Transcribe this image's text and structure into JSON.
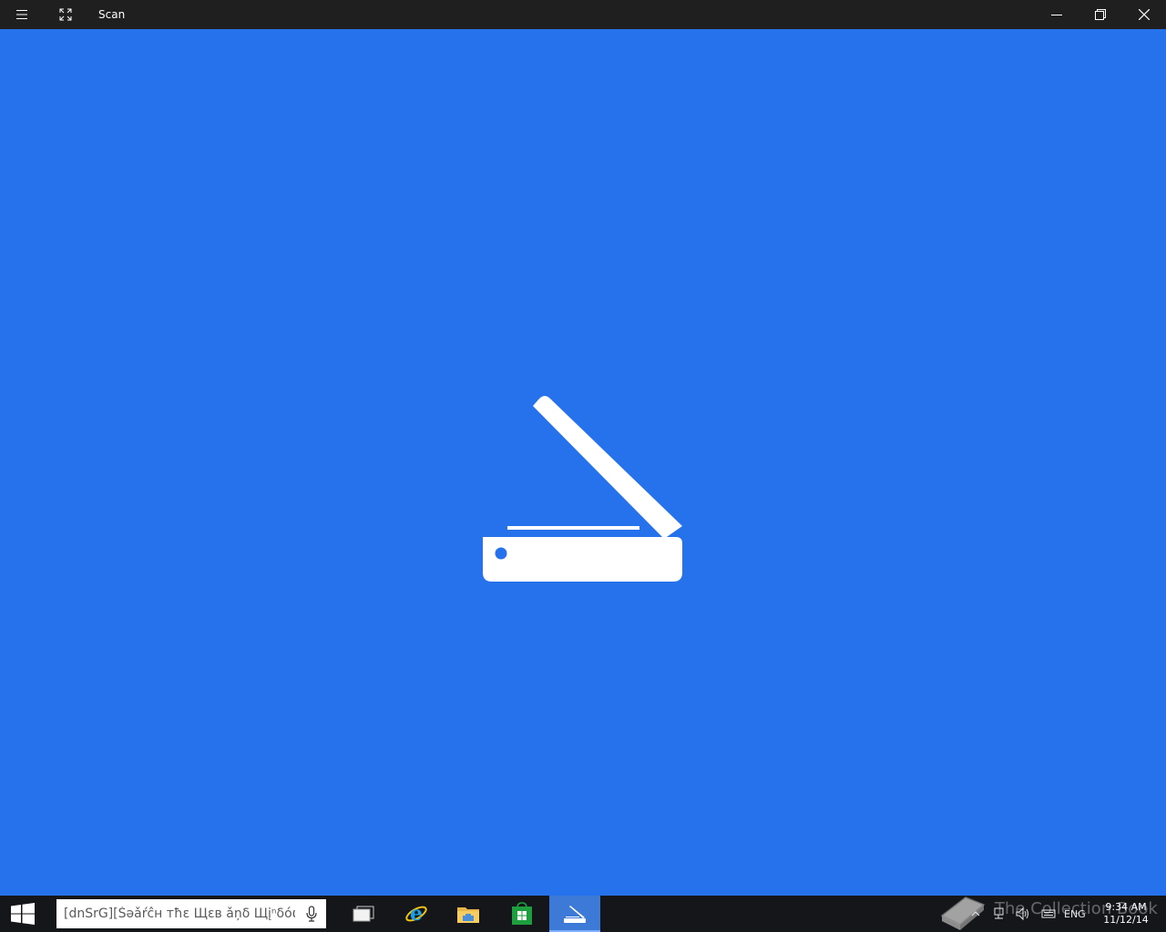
{
  "window": {
    "title": "Scan"
  },
  "app": {
    "icon": "scanner-icon",
    "background": "#2672ec"
  },
  "taskbar": {
    "search_placeholder": "[dnSrG][Šəǎŕĉн тħε Щεв ǎņδ Щįⁿδóωŝ",
    "apps": [
      {
        "name": "task-view-icon"
      },
      {
        "name": "internet-explorer-icon"
      },
      {
        "name": "file-explorer-icon"
      },
      {
        "name": "store-icon"
      },
      {
        "name": "scan-app-icon",
        "active": true
      }
    ],
    "tray": {
      "language": "ENG",
      "time": "9:34 AM",
      "date": "11/12/14"
    },
    "watermark": "The Collection Book"
  }
}
